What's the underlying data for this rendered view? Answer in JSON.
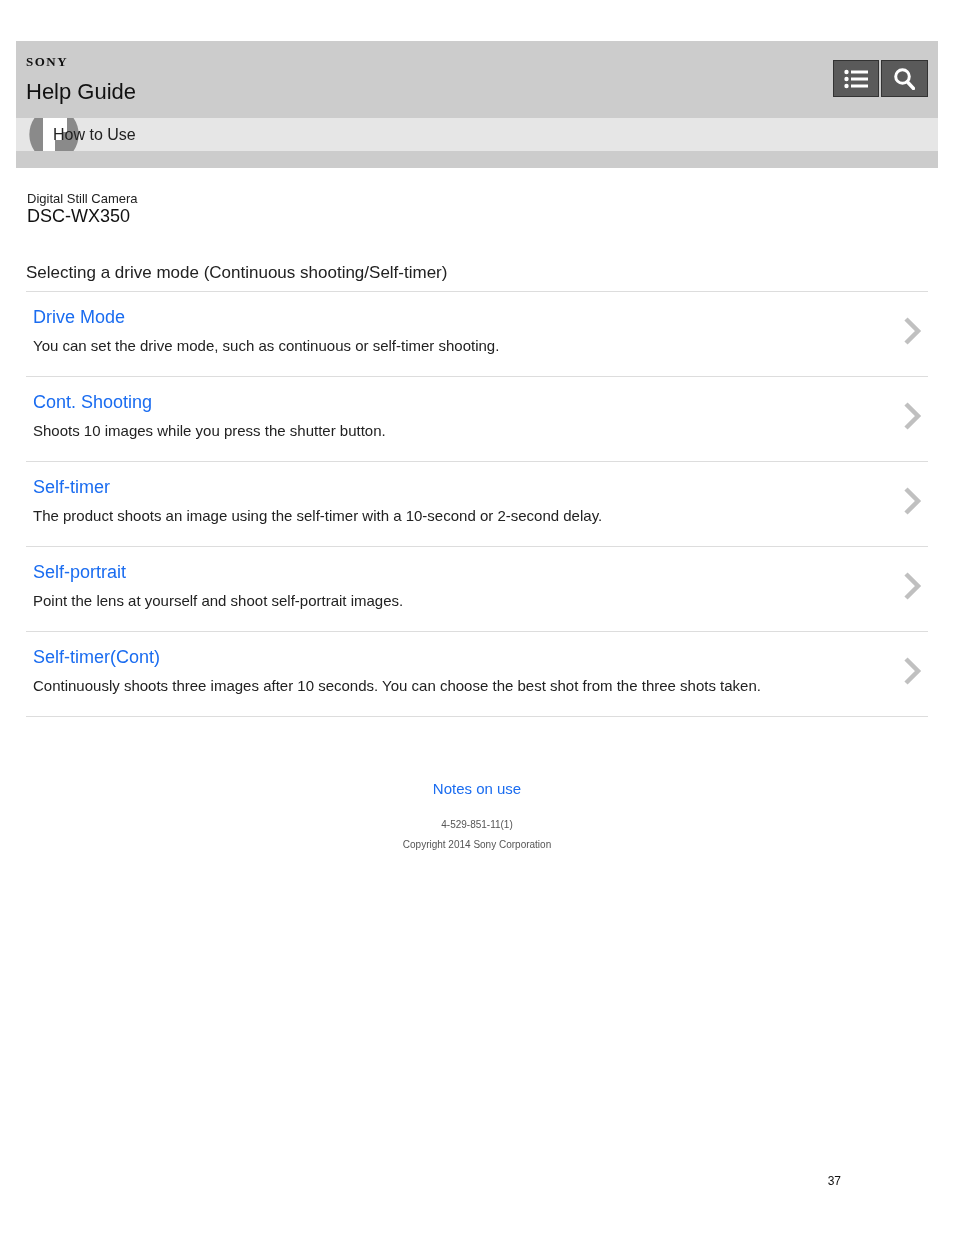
{
  "header": {
    "logo": "SONY",
    "title": "Help Guide"
  },
  "breadcrumb": {
    "label": "How to Use"
  },
  "product": {
    "category": "Digital Still Camera",
    "model": "DSC-WX350"
  },
  "page_title": "Selecting a drive mode (Continuous shooting/Self-timer)",
  "topics": [
    {
      "title": "Drive Mode",
      "description": "You can set the drive mode, such as continuous or self-timer shooting."
    },
    {
      "title": "Cont. Shooting",
      "description": "Shoots 10 images while you press the shutter button."
    },
    {
      "title": "Self-timer",
      "description": "The product shoots an image using the self-timer with a 10-second or 2-second delay."
    },
    {
      "title": "Self-portrait",
      "description": "Point the lens at yourself and shoot self-portrait images."
    },
    {
      "title": "Self-timer(Cont)",
      "description": "Continuously shoots three images after 10 seconds. You can choose the best shot from the three shots taken."
    }
  ],
  "footer": {
    "link": "Notes on use",
    "code": "4-529-851-11(1)",
    "copyright": "Copyright 2014 Sony Corporation"
  },
  "page_number": "37"
}
